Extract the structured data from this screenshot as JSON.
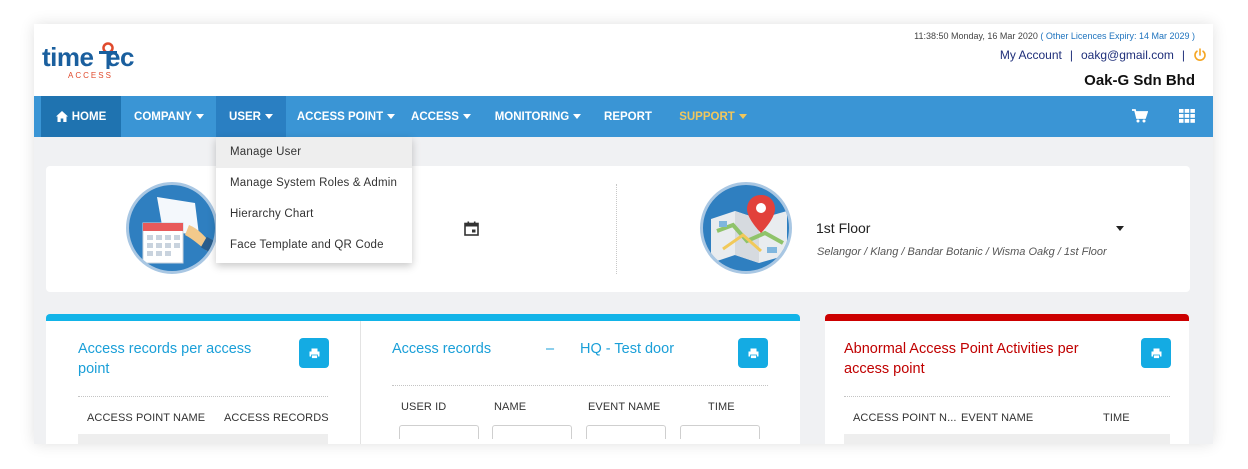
{
  "brand": {
    "logo_text_left": "time",
    "logo_text_right": "ec",
    "logo_sub": "ACCESS",
    "colors": {
      "primary": "#1a5f9e",
      "accent": "#e04a2c"
    }
  },
  "header": {
    "datetime": "11:38:50 Monday, 16 Mar 2020",
    "licence_text": "( Other Licences Expiry:  14 Mar 2029 )",
    "my_account": "My Account",
    "separator": "|",
    "email": "oakg@gmail.com",
    "company": "Oak-G Sdn Bhd",
    "power_icon": "power-icon"
  },
  "nav": {
    "bg_color": "#3a95d5",
    "home_label": "HOME",
    "company_label": "COMPANY",
    "user_label": "USER",
    "access_point_label": "ACCESS POINT",
    "access_label": "ACCESS",
    "monitoring_label": "MONITORING",
    "report_label": "REPORT",
    "support_label": "SUPPORT",
    "cart_icon": "cart-icon",
    "apps_icon": "grid-icon"
  },
  "user_menu": {
    "items": [
      {
        "label": "Manage User"
      },
      {
        "label": "Manage System Roles & Admin"
      },
      {
        "label": "Hierarchy Chart"
      },
      {
        "label": "Face Template and QR Code"
      }
    ]
  },
  "location": {
    "floor": "1st Floor",
    "path": "Selangor / Klang / Bandar Botanic / Wisma Oakg / 1st Floor"
  },
  "panels": {
    "access_per_point": {
      "title": "Access records per access point",
      "columns": [
        "ACCESS POINT NAME",
        "ACCESS RECORDS"
      ]
    },
    "access_records": {
      "title": "Access records",
      "dash": "–",
      "door": "HQ - Test door",
      "columns": [
        "USER ID",
        "NAME",
        "EVENT NAME",
        "TIME"
      ]
    },
    "abnormal": {
      "title": "Abnormal Access Point Activities per access point",
      "columns": [
        "ACCESS POINT N...",
        "EVENT NAME",
        "TIME"
      ],
      "accent": "#cc0000"
    }
  }
}
